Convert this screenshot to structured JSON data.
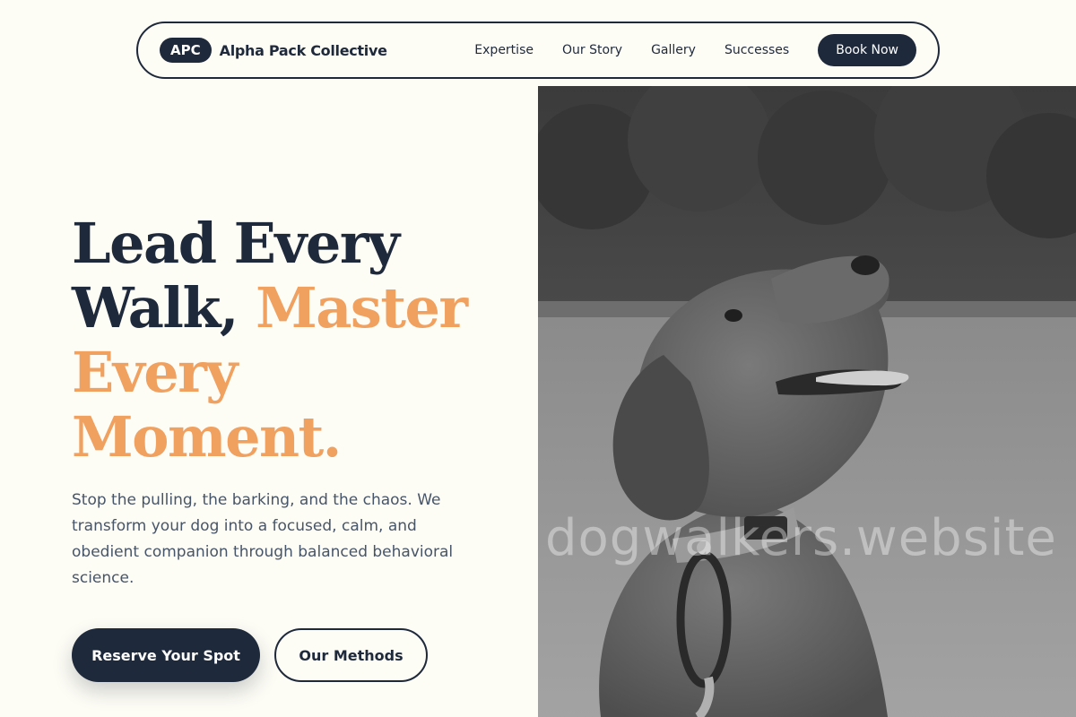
{
  "brand": {
    "badge": "APC",
    "name": "Alpha Pack Collective"
  },
  "nav": {
    "links": [
      "Expertise",
      "Our Story",
      "Gallery",
      "Successes"
    ],
    "cta": "Book Now"
  },
  "hero": {
    "title_line1": "Lead Every",
    "title_line2_dark": "Walk,",
    "title_line2_accent": "Master",
    "title_line3": "Every",
    "title_line4": "Moment.",
    "subtitle": "Stop the pulling, the barking, and the chaos. We transform your dog into a focused, calm, and obedient companion through balanced behavioral science.",
    "primary_button": "Reserve Your Spot",
    "secondary_button": "Our Methods"
  },
  "image": {
    "watermark": "dogwalkers.website"
  },
  "colors": {
    "navy": "#1e293b",
    "accent": "#f0a05f",
    "background": "#fdfcf5",
    "body_text": "#475569"
  }
}
